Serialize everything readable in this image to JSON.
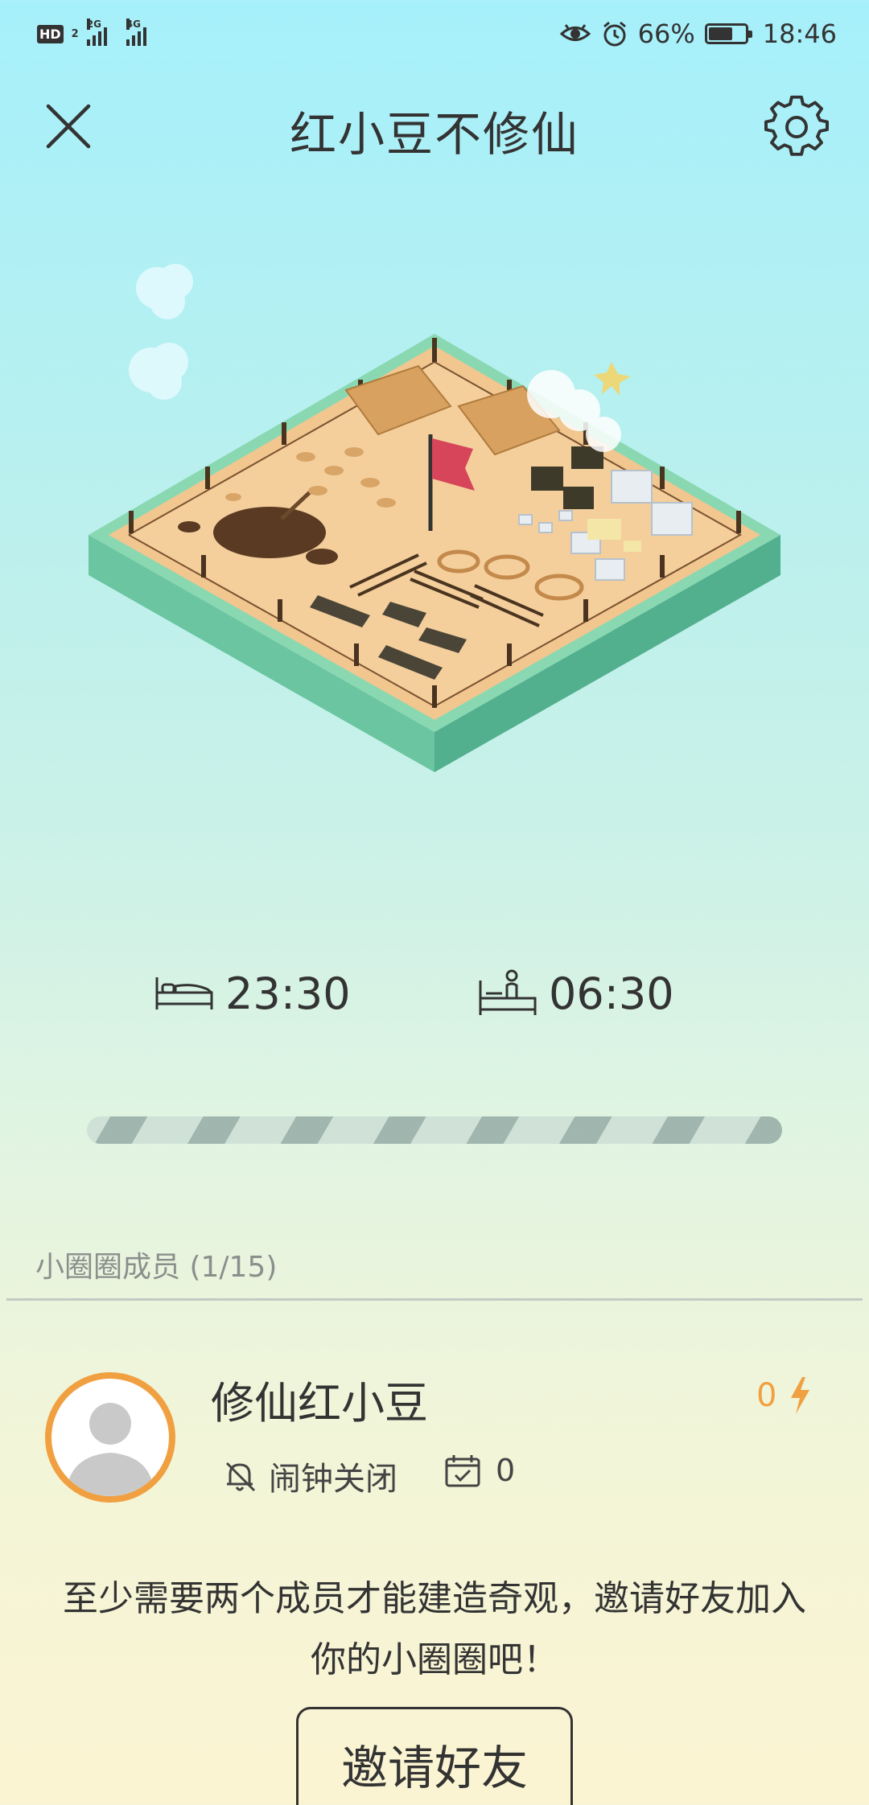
{
  "status_bar": {
    "hd_label": "HD",
    "hd_sub": "2",
    "signal1_label": "2G",
    "signal2_label": "4G",
    "battery_percent": "66%",
    "battery_level": 0.66,
    "time": "18:46",
    "icons": [
      "eye-icon",
      "alarm-clock-icon",
      "battery-icon"
    ]
  },
  "header": {
    "title": "红小豆不修仙",
    "close_icon": "close-icon",
    "settings_icon": "gear-icon"
  },
  "schedule": {
    "bedtime": "23:30",
    "waketime": "06:30",
    "bed_icon": "bed-icon",
    "wake_icon": "wake-up-icon"
  },
  "circle": {
    "members_label": "小圈圈成员 (1/15)",
    "members": [
      {
        "name": "修仙红小豆",
        "energy": "0",
        "alarm_status": "闹钟关闭",
        "checkin_count": "0"
      }
    ],
    "invite_message": "至少需要两个成员才能建造奇观，邀请好友加入你的小圈圈吧！",
    "invite_button": "邀请好友"
  },
  "colors": {
    "accent_orange": "#f0a040",
    "text_dark": "#333333",
    "text_muted": "#8a8f8c",
    "flag_red": "#d6455a"
  }
}
